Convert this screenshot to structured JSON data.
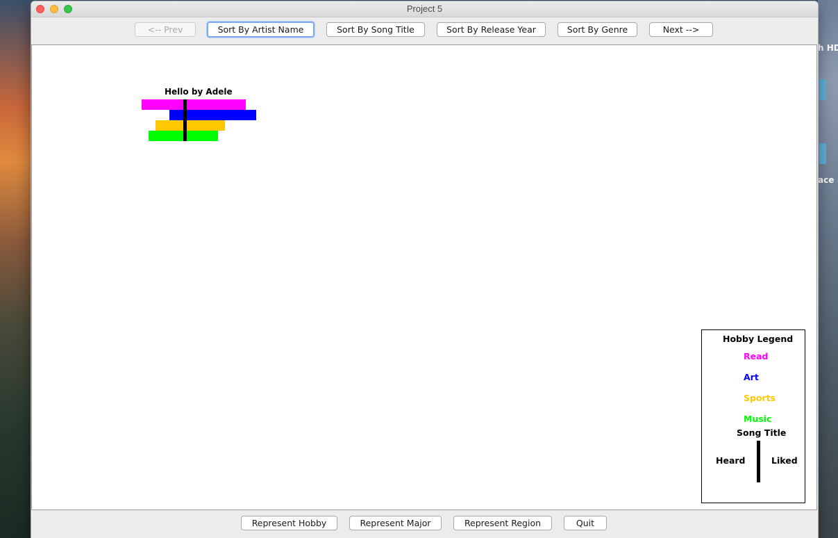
{
  "window": {
    "title": "Project 5"
  },
  "desktop": {
    "label_top": "h HD",
    "label_mid": "ace"
  },
  "toolbar": {
    "prev_label": "<-- Prev",
    "sort_artist_label": "Sort By Artist Name",
    "sort_title_label": "Sort By Song Title",
    "sort_year_label": "Sort By Release Year",
    "sort_genre_label": "Sort By Genre",
    "next_label": "Next -->"
  },
  "glyph": {
    "title": "Hello by Adele",
    "bars": [
      {
        "hobby": "Read",
        "color": "#ff00ff"
      },
      {
        "hobby": "Art",
        "color": "#0000ff"
      },
      {
        "hobby": "Sports",
        "color": "#ffc800"
      },
      {
        "hobby": "Music",
        "color": "#00ff00"
      }
    ]
  },
  "legend": {
    "title": "Hobby Legend",
    "items": [
      {
        "label": "Read",
        "color": "#ff00ff"
      },
      {
        "label": "Art",
        "color": "#0000ff"
      },
      {
        "label": "Sports",
        "color": "#ffc800"
      },
      {
        "label": "Music",
        "color": "#00ff00"
      }
    ],
    "song_title": "Song Title",
    "heard": "Heard",
    "liked": "Liked"
  },
  "bottombar": {
    "hobby_label": "Represent Hobby",
    "major_label": "Represent Major",
    "region_label": "Represent Region",
    "quit_label": "Quit"
  }
}
